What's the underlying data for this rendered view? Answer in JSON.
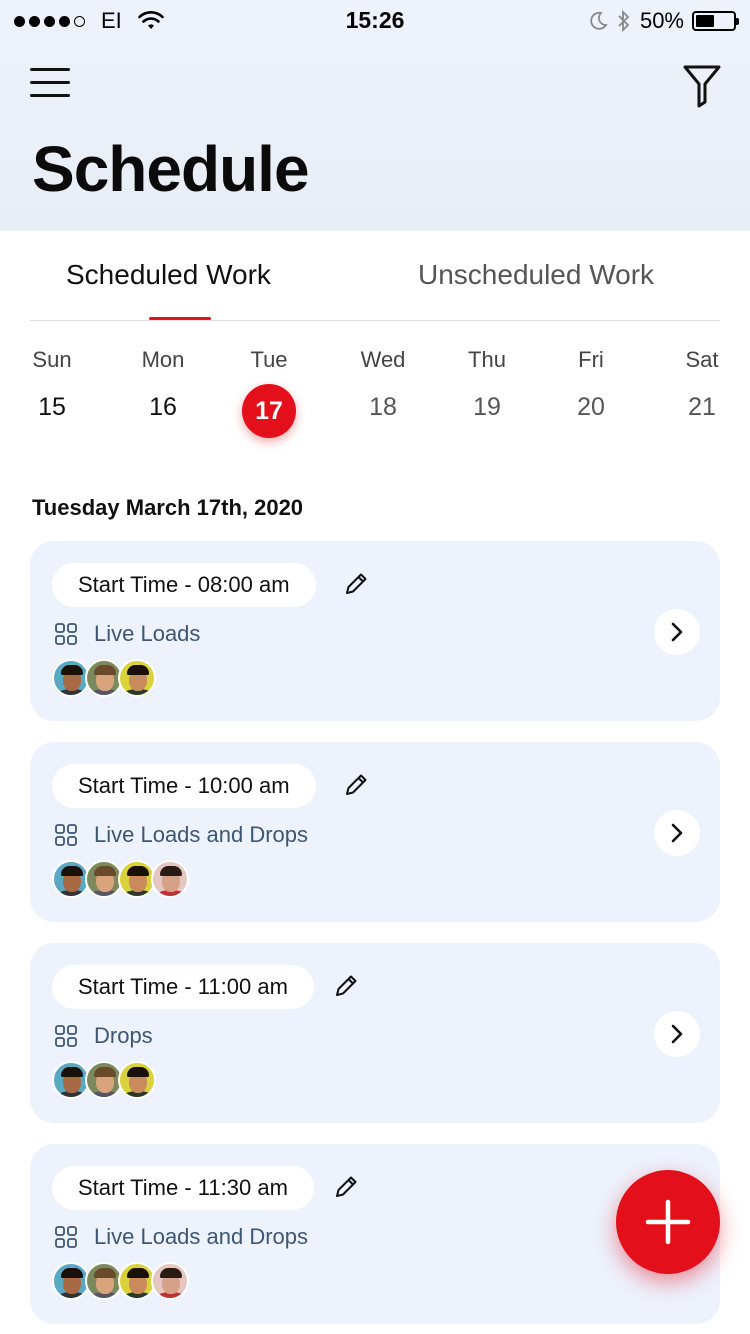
{
  "status_bar": {
    "carrier": "EI",
    "time": "15:26",
    "battery": "50%",
    "battery_level": 0.5
  },
  "header": {
    "menu_icon": "hamburger-icon",
    "filter_icon": "filter-icon",
    "title": "Schedule"
  },
  "tabs": {
    "active": "Scheduled Work",
    "inactive": "Unscheduled Work"
  },
  "week": [
    {
      "name": "Sun",
      "num": "15"
    },
    {
      "name": "Mon",
      "num": "16"
    },
    {
      "name": "Tue",
      "num": "17"
    },
    {
      "name": "Wed",
      "num": "18"
    },
    {
      "name": "Thu",
      "num": "19"
    },
    {
      "name": "Fri",
      "num": "20"
    },
    {
      "name": "Sat",
      "num": "21"
    }
  ],
  "selected_day": "17",
  "date_heading": "Tuesday March 17th, 2020",
  "cards": [
    {
      "time": "Start Time - 08:00 am",
      "task": "Live Loads"
    },
    {
      "time": "Start Time - 10:00 am",
      "task": "Live Loads and Drops"
    },
    {
      "time": "Start Time - 11:00 am",
      "task": "Drops"
    },
    {
      "time": "Start Time - 11:30 am",
      "task": "Live Loads and Drops"
    }
  ],
  "colors": {
    "accent": "#e3101b",
    "card_bg": "#edf2fd",
    "task_text": "#3d5674"
  }
}
